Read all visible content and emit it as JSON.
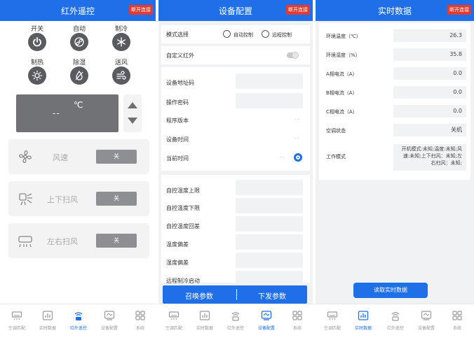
{
  "colors": {
    "primary": "#1e6fe8",
    "connect_badge": "#e23b32",
    "mode_button": "#595b60",
    "display": "#707275"
  },
  "ir_remote": {
    "title": "红外遥控",
    "connect_label": "断开连接",
    "modes": [
      {
        "label": "开关",
        "icon": "power-icon"
      },
      {
        "label": "自动",
        "icon": "auto-swirl-icon"
      },
      {
        "label": "制冷",
        "icon": "snowflake-icon"
      },
      {
        "label": "制热",
        "icon": "sun-icon"
      },
      {
        "label": "除湿",
        "icon": "drop-slash-icon"
      },
      {
        "label": "送风",
        "icon": "wind-icon"
      }
    ],
    "display": {
      "temp": "--",
      "unit": "℃"
    },
    "fan_speed": {
      "label": "风速",
      "value": "关"
    },
    "swing_vertical": {
      "label": "上下扫风",
      "value": "关"
    },
    "swing_horizontal": {
      "label": "左右扫风",
      "value": "关"
    }
  },
  "tabs": [
    "空调匹配",
    "实时数据",
    "红外遥控",
    "设备配置",
    "系统"
  ],
  "config": {
    "title": "设备配置",
    "connect_label": "断开连接",
    "mode_select": {
      "label": "模式选择",
      "option1": "自动控制",
      "option2": "远程控制"
    },
    "custom_ir": "自定义红外",
    "fields": {
      "device_address": "设备地址码",
      "password": "操作密码",
      "firmware": "程序版本",
      "device_time": "设备时间",
      "current_time": "当前时间",
      "current_time_value": "--",
      "device_time_value": "--",
      "firmware_value": "--"
    },
    "temp_fields": [
      "自控温度上限",
      "自控温度下限",
      "自控温度回差",
      "温度偏差",
      "湿度偏差",
      "远程制冷启动"
    ],
    "recall_label": "召唤参数",
    "send_label": "下发参数"
  },
  "realtime": {
    "title": "实时数据",
    "connect_label": "断开连接",
    "rows": [
      {
        "label": "环境温度（℃）",
        "value": "26.3"
      },
      {
        "label": "环境湿度（%）",
        "value": "35.8"
      },
      {
        "label": "A相电流（A）",
        "value": "0.0"
      },
      {
        "label": "B相电流（A）",
        "value": "0.0"
      },
      {
        "label": "C相电流（A）",
        "value": "0.0"
      },
      {
        "label": "空调状态",
        "value": "关机"
      }
    ],
    "work_mode": {
      "label": "工作模式",
      "line1": "开机模式:未知;温度:未知;风",
      "line2": "速:未知;上下扫风：未知;左",
      "line3": "右扫风：未知;"
    },
    "read_button": "读取实时数据"
  }
}
